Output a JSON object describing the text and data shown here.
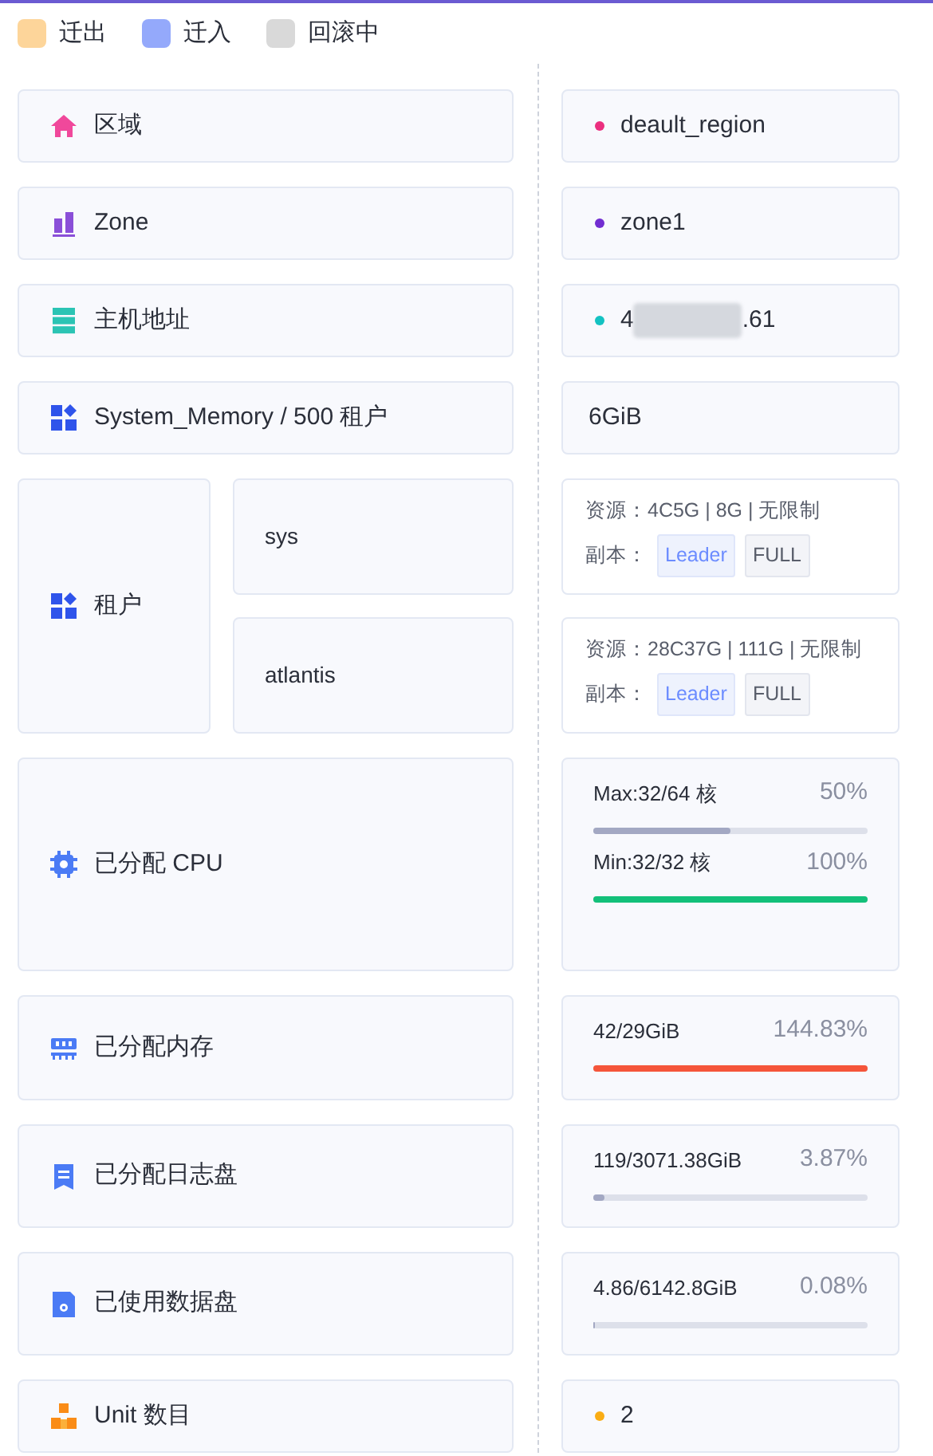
{
  "legend": [
    {
      "label": "迁出",
      "color": "#fdd59a"
    },
    {
      "label": "迁入",
      "color": "#94a9fb"
    },
    {
      "label": "回滚中",
      "color": "#d9d9d9"
    }
  ],
  "rows": [
    {
      "kind": "dot",
      "label": "区域",
      "value": "deault_region",
      "color": "#eb2f7f"
    },
    {
      "kind": "dot",
      "label": "Zone",
      "value": "zone1",
      "color": "#722ed1"
    },
    {
      "kind": "masked",
      "label": "主机地址",
      "value_start": "4",
      "value_end": ".61",
      "color": "#13c2c2"
    },
    {
      "kind": "plain",
      "label": "System_Memory / 500 租户",
      "value": "6GiB"
    },
    {
      "kind": "tenants",
      "label": "租户",
      "tenants": [
        {
          "name": "sys",
          "resources": "资源：4C5G | 8G | 无限制",
          "replica_label": "副本：",
          "replicas": [
            {
              "label": "Leader",
              "active": true
            },
            {
              "label": "FULL",
              "active": false
            }
          ]
        },
        {
          "name": "atlantis",
          "resources": "资源：28C37G | 111G | 无限制",
          "replica_label": "副本：",
          "replicas": [
            {
              "label": "Leader",
              "active": true
            },
            {
              "label": "FULL",
              "active": false
            }
          ]
        }
      ]
    },
    {
      "kind": "progress",
      "label": "已分配 CPU",
      "bars": [
        {
          "text": "Max:32/64 核",
          "percent": "50%",
          "level": 0.5,
          "color": "#a3a8c3"
        },
        {
          "text": "Min:32/32 核",
          "percent": "100%",
          "level": 1,
          "color": "#13c07a"
        }
      ]
    },
    {
      "kind": "progress",
      "label": "已分配内存",
      "bars": [
        {
          "text": "42/29GiB",
          "percent": "144.83%",
          "level": 1,
          "color": "#f5553a"
        }
      ]
    },
    {
      "kind": "progress",
      "label": "已分配日志盘",
      "bars": [
        {
          "text": "119/3071.38GiB",
          "percent": "3.87%",
          "level": 0.04,
          "color": "#a3a8c3"
        }
      ]
    },
    {
      "kind": "progress",
      "label": "已使用数据盘",
      "bars": [
        {
          "text": "4.86/6142.8GiB",
          "percent": "0.08%",
          "level": 0.0008,
          "color": "#a3a8c3"
        }
      ]
    },
    {
      "kind": "dot",
      "label": "Unit 数目",
      "value": "2",
      "color": "#faad14"
    }
  ]
}
